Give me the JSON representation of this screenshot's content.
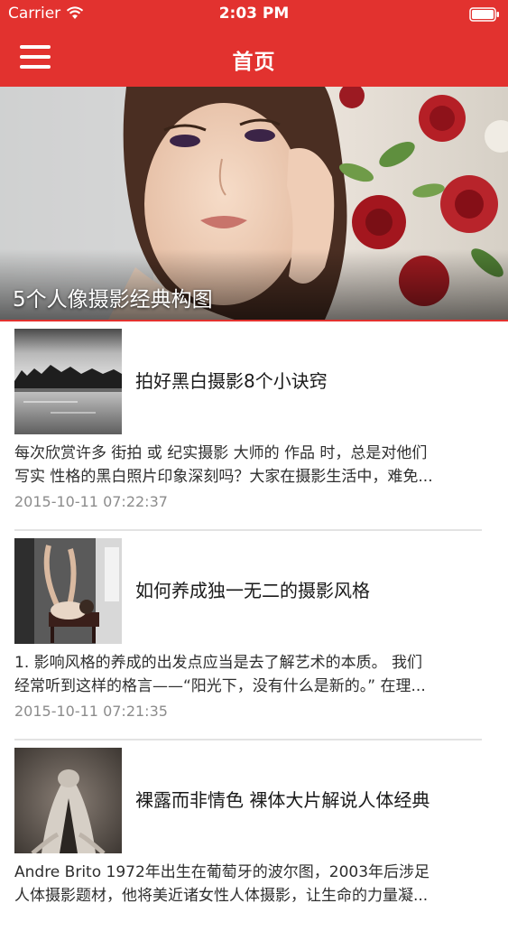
{
  "status_bar": {
    "carrier": "Carrier",
    "time": "2:03 PM"
  },
  "nav": {
    "title": "首页",
    "menu_icon": "hamburger-menu-icon",
    "color": "#e2322f"
  },
  "banner": {
    "title": "5个人像摄影经典构图"
  },
  "articles": [
    {
      "title": "拍好黑白摄影8个小诀窍",
      "summary_line1": "每次欣赏许多 街拍 或 纪实摄影 大师的 作品 时，总是对他们",
      "summary_line2": "写实 性格的黑白照片印象深刻吗？大家在摄影生活中，难免...",
      "date": "2015-10-11 07:22:37"
    },
    {
      "title": "如何养成独一无二的摄影风格",
      "summary_line1": "1. 影响风格的养成的出发点应当是去了解艺术的本质。 我们",
      "summary_line2": "经常听到这样的格言——“阳光下，没有什么是新的。” 在理...",
      "date": "2015-10-11 07:21:35"
    },
    {
      "title": "裸露而非情色 裸体大片解说人体经典",
      "summary_line1": "Andre Brito 1972年出生在葡萄牙的波尔图，2003年后涉足",
      "summary_line2": "人体摄影题材，他将美近诸女性人体摄影，让生命的力量凝..."
    }
  ]
}
